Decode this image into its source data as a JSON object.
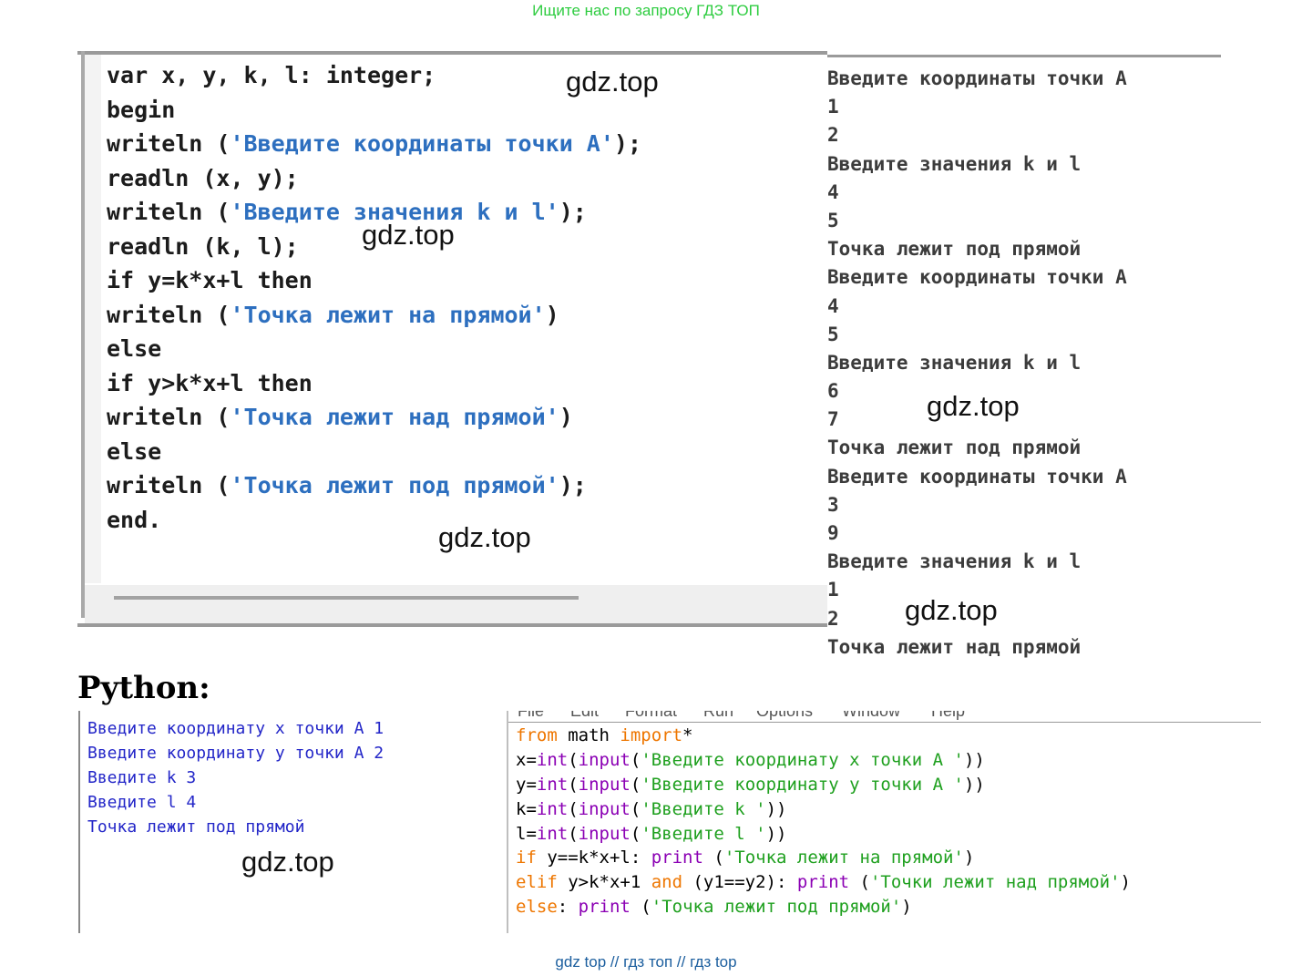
{
  "top_banner": "Ищите нас по запросу ГДЗ ТОП",
  "bottom_banner": "gdz top  //  гдз топ  //  гдз top",
  "watermark": "gdz.top",
  "pascal_code": [
    "var x, y, k, l: integer;",
    "begin",
    "writeln ('Введите координаты точки А');",
    "readln (x, y);",
    "writeln ('Введите значения k и l');",
    "readln (k, l);",
    "if y=k*x+l then",
    "writeln ('Точка лежит на прямой')",
    "else",
    "if y>k*x+l then",
    "writeln ('Точка лежит над прямой')",
    "else",
    "writeln ('Точка лежит под прямой');",
    "end."
  ],
  "pascal_output": [
    "Введите координаты точки А",
    "1",
    "2",
    "Введите значения k и l",
    "4",
    "5",
    "Точка лежит под прямой",
    "Введите координаты точки А",
    "4",
    "5",
    "Введите значения k и l",
    "6",
    "7",
    "Точка лежит под прямой",
    "Введите координаты точки А",
    "3",
    "9",
    "Введите значения k и l",
    "1",
    "2",
    "Точка лежит над прямой"
  ],
  "python_heading": "Python:",
  "python_shell_output": [
    "Введите координату x точки А 1",
    "Введите координату y точки А 2",
    "Введите k 3",
    "Введите l 4",
    "Точка лежит под прямой"
  ],
  "idle_menu": [
    "File",
    "Edit",
    "Format",
    "Run",
    "Options",
    "Window",
    "Help"
  ],
  "python_code": [
    "from math import*",
    "x=int(input('Введите координату x точки А '))",
    "y=int(input('Введите координату y точки А '))",
    "k=int(input('Введите k '))",
    "l=int(input('Введите l '))",
    "if y==k*x+l: print ('Точка лежит на прямой')",
    "elif y>k*x+1 and (y1==y2): print ('Точки лежит над прямой')",
    "else: print ('Точка лежит под прямой')"
  ],
  "colors": {
    "banner_top": "#2ecc40",
    "banner_bottom": "#1b5e9e",
    "pascal_string": "#2d6fbf",
    "idle_keyword": "#ee7600",
    "idle_builtin": "#8b00b4",
    "idle_string": "#1fa01f",
    "idle_output": "#2326c8"
  }
}
